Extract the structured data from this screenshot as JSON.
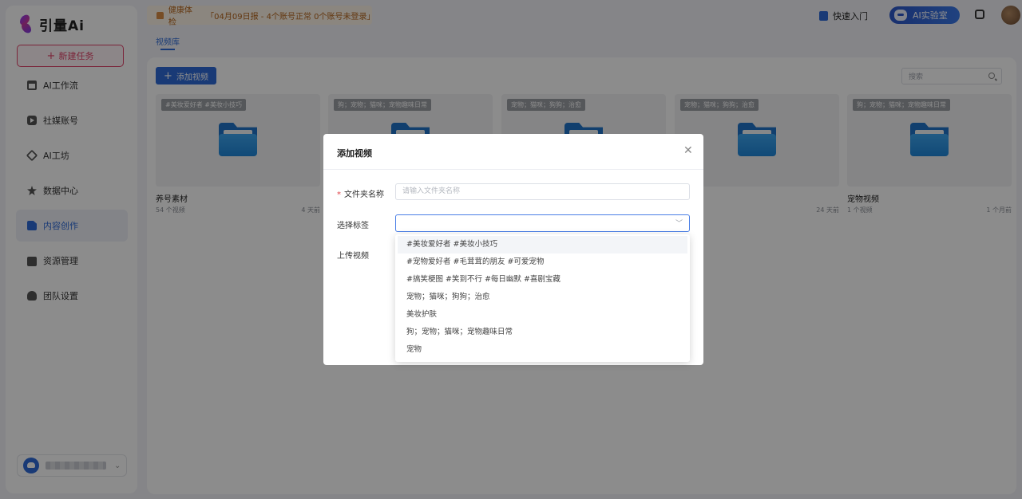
{
  "sidebar": {
    "logo_text": "引量Ai",
    "new_task_label": "新建任务",
    "items": [
      {
        "label": "AI工作流"
      },
      {
        "label": "社媒账号"
      },
      {
        "label": "AI工坊"
      },
      {
        "label": "数据中心"
      },
      {
        "label": "内容创作"
      },
      {
        "label": "资源管理"
      },
      {
        "label": "团队设置"
      }
    ]
  },
  "header": {
    "notice_title": "健康体检",
    "notice_text": "「04月09日报 - 4个账号正常 0个账号未登录」",
    "quick_start": "快速入门",
    "ai_lab": "AI实验室"
  },
  "main": {
    "tab": "视频库",
    "add_video": "添加视频",
    "search_placeholder": "搜索",
    "cards": [
      {
        "tag": "#美妆爱好者 #美妆小技巧",
        "title": "养号素材",
        "count": "54 个视频",
        "time": "4 天前"
      },
      {
        "tag": "狗；宠物；猫咪；宠物趣味日常",
        "title": "",
        "count": "",
        "time": ""
      },
      {
        "tag": "宠物；猫咪；狗狗；治愈",
        "title": "",
        "count": "",
        "time": ""
      },
      {
        "tag": "宠物；猫咪；狗狗；治愈",
        "title": "",
        "count": "",
        "time": "24 天前"
      },
      {
        "tag": "狗；宠物；猫咪；宠物趣味日常",
        "title": "宠物视频",
        "count": "1 个视频",
        "time": "1 个月前"
      }
    ]
  },
  "modal": {
    "title": "添加视频",
    "folder_name_label": "文件夹名称",
    "folder_name_placeholder": "请输入文件夹名称",
    "tag_label": "选择标签",
    "upload_label": "上传视频",
    "tag_options": [
      "#美妆爱好者 #美妆小技巧",
      "#宠物爱好者 #毛茸茸的朋友 #可爱宠物",
      "#搞笑梗图 #笑到不行 #每日幽默 #喜剧宝藏",
      "宠物；猫咪；狗狗；治愈",
      "美妆护肤",
      "狗；宠物；猫咪；宠物趣味日常",
      "宠物"
    ]
  }
}
